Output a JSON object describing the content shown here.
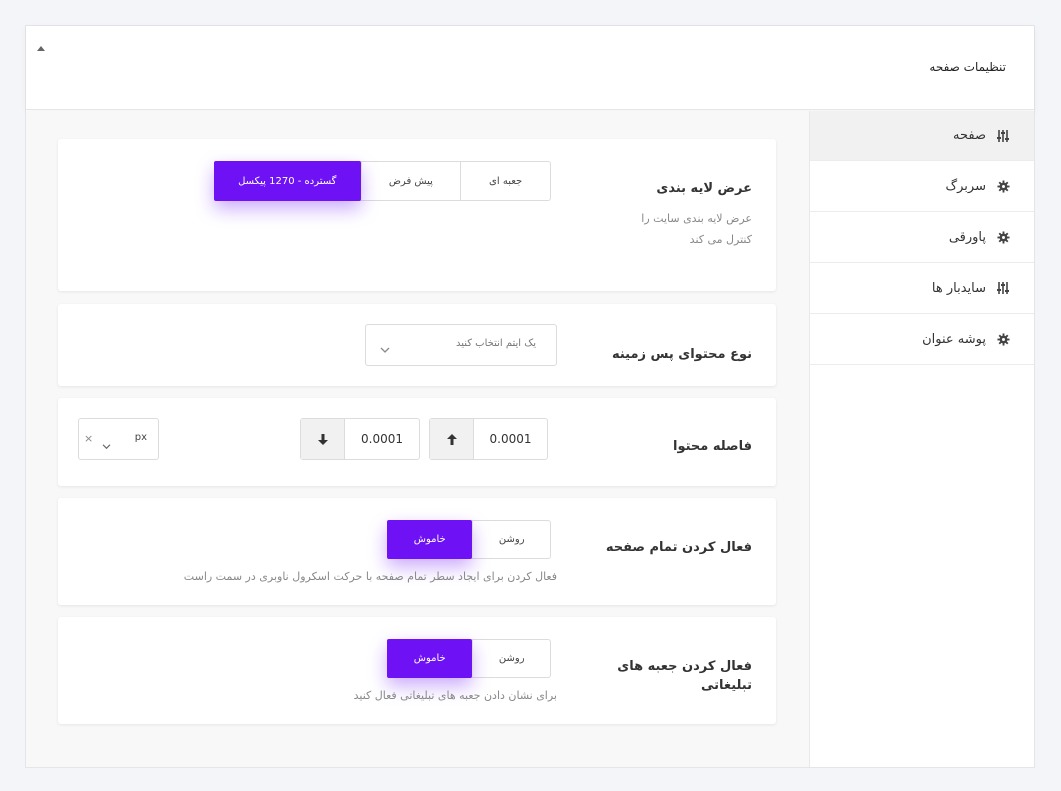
{
  "header": {
    "title": "تنظیمات صفحه"
  },
  "sidebar": {
    "items": [
      {
        "label": "صفحه",
        "icon": "sliders-icon"
      },
      {
        "label": "سربرگ",
        "icon": "gear-icon"
      },
      {
        "label": "پاورقی",
        "icon": "gear-icon"
      },
      {
        "label": "سایدبار ها",
        "icon": "sliders-icon"
      },
      {
        "label": "پوشه عنوان",
        "icon": "gear-icon"
      }
    ]
  },
  "layout_width": {
    "label": "عرض لایه بندی",
    "desc_line1": "عرض لایه بندی سایت را",
    "desc_line2": "کنترل می کند",
    "options": [
      "گسترده - 1270 پیکسل",
      "پیش فرض",
      "جعبه ای"
    ],
    "selected": "گسترده - 1270 پیکسل"
  },
  "background": {
    "label": "نوع محتوای پس زمینه",
    "placeholder": "یک ایتم انتخاب کنید"
  },
  "spacing": {
    "label": "فاصله محتوا",
    "top_value": "0.0001",
    "bottom_value": "0.0001",
    "unit": "px",
    "clear": "×"
  },
  "fullpage": {
    "label": "فعال کردن تمام صفحه",
    "on_label": "روشن",
    "off_label": "خاموش",
    "selected": "خاموش",
    "desc": "فعال کردن برای ایجاد سطر تمام صفحه با حرکت اسکرول ناوبری در سمت راست"
  },
  "ads": {
    "label_line1": "فعال کردن جعبه های",
    "label_line2": "تبلیغاتی",
    "on_label": "روشن",
    "off_label": "خاموش",
    "selected": "خاموش",
    "desc": "برای نشان دادن جعبه های تبلیغاتی فعال کنید"
  },
  "colors": {
    "accent": "#6e12f5"
  }
}
